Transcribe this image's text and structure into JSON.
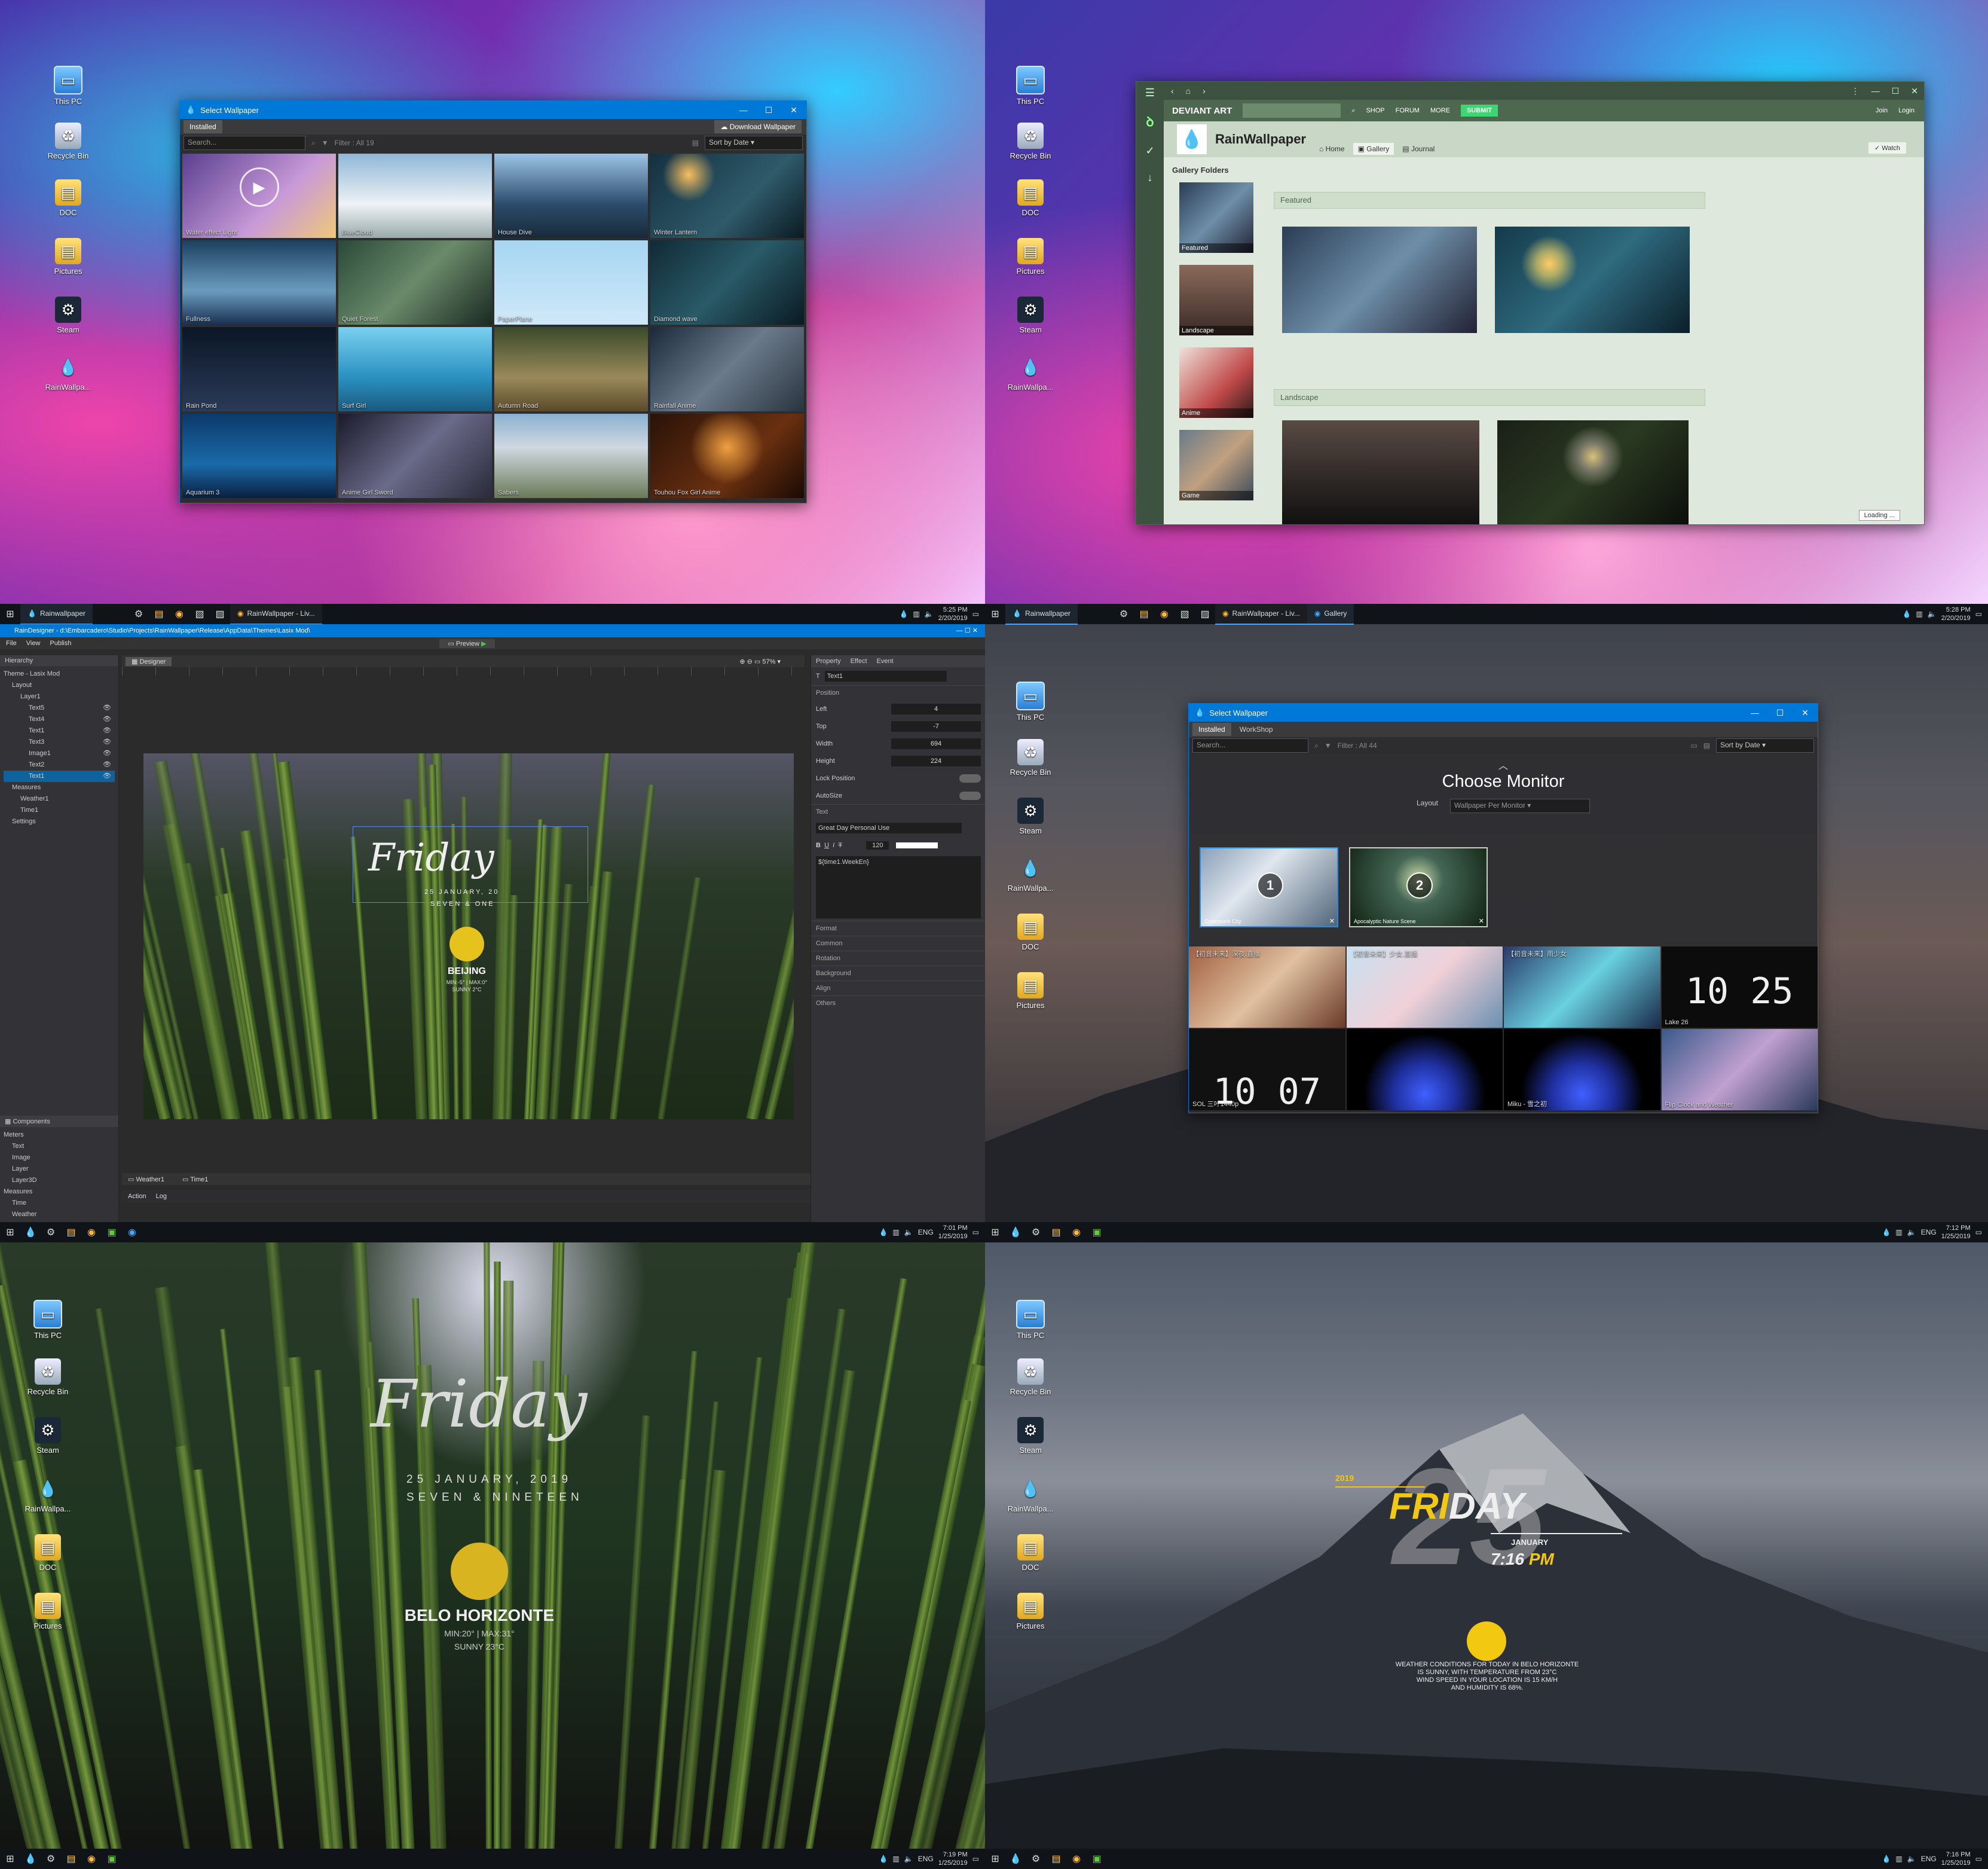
{
  "desktop_icons": {
    "pc": "This PC",
    "bin": "Recycle Bin",
    "doc": "DOC",
    "pics": "Pictures",
    "steam": "Steam",
    "rain": "RainWallpa..."
  },
  "q1": {
    "title": "Select Wallpaper",
    "tab_installed": "Installed",
    "download_btn": "Download Wallpaper",
    "search_placeholder": "Search...",
    "filter": "Filter : All 19",
    "sort": "Sort by Date",
    "tiles": [
      "Water effect Light",
      "BlueCloud",
      "House Dive",
      "Winter Lantern",
      "Fullness",
      "Quiet Forest",
      "PaperPlane",
      "Diamond wave",
      "Rain Pond",
      "Surf Girl",
      "Autumn Road",
      "Rainfall Anime",
      "Aquarium 3",
      "Anime Girl Sword",
      "Sabers",
      "Touhou Fox Girl Anime"
    ]
  },
  "q2": {
    "brand": "DEVIANT ART",
    "nav": [
      "SHOP",
      "FORUM",
      "MORE"
    ],
    "submit": "SUBMIT",
    "join": "Join",
    "login": "Login",
    "profile": "RainWallpaper",
    "tabs": [
      "Home",
      "Gallery",
      "Journal"
    ],
    "watch": "Watch",
    "gallery_folders": "Gallery Folders",
    "folders": [
      "Featured",
      "Landscape",
      "Anime",
      "Game"
    ],
    "featured": "Featured",
    "landscape": "Landscape",
    "loading": "Loading ..."
  },
  "q3": {
    "taskbar_app": "Rainwallpaper",
    "taskbar_chrome": "RainWallpaper - Liv...",
    "time": "5:25 PM",
    "date": "2/20/2019",
    "title": "RainDesigner - d:\\Embarcadero\\Studio\\Projects\\RainWallpaper\\Release\\AppData\\Themes\\Lasix Mod\\",
    "menu": [
      "File",
      "View",
      "Publish"
    ],
    "preview": "Preview",
    "hierarchy": "Hierarchy",
    "designer": "Designer",
    "zoom": "57%",
    "tree": [
      "Theme - Lasix Mod",
      "Layout",
      "Layer1",
      "Text5",
      "Text4",
      "Text1",
      "Text3",
      "Image1",
      "Text2",
      "Text1",
      "Measures",
      "Weather1",
      "Time1",
      "Settings"
    ],
    "components": "Components",
    "comp_tree": [
      "Meters",
      "Text",
      "Image",
      "Layer",
      "Layer3D",
      "Measures",
      "Time",
      "Weather"
    ],
    "prop_tabs": [
      "Property",
      "Effect",
      "Event"
    ],
    "selected": "Text1",
    "position": "Position",
    "props": [
      {
        "k": "Left",
        "v": "4"
      },
      {
        "k": "Top",
        "v": "-7"
      },
      {
        "k": "Width",
        "v": "694"
      },
      {
        "k": "Height",
        "v": "224"
      }
    ],
    "lock": "Lock Position",
    "autosize": "AutoSize",
    "text_sect": "Text",
    "font": "Great Day Personal Use",
    "font_size": "120",
    "text_value": "${time1.WeekEn}",
    "sections": [
      "Format",
      "Common",
      "Rotation",
      "Background",
      "Align",
      "Others"
    ],
    "day": "Friday",
    "date_line": "25 JANUARY, 20",
    "sub_line": "SEVEN & ONE",
    "city": "BEIJING",
    "minmax": "MIN:-5° | MAX:0°",
    "cond": "SUNNY 2°C",
    "bottom_tabs": [
      "Weather1",
      "Time1"
    ],
    "log_tabs": [
      "Action",
      "Log"
    ]
  },
  "q4": {
    "taskbar_app": "Rainwallpaper",
    "taskbar_chrome": "RainWallpaper - Liv...",
    "taskbar_gallery": "Gallery",
    "time": "5:28 PM",
    "date": "2/20/2019",
    "title": "Select Wallpaper",
    "tabs": [
      "Installed",
      "WorkShop"
    ],
    "search_placeholder": "Search...",
    "filter": "Filter : All 44",
    "sort": "Sort by Date",
    "choose": "Choose Monitor",
    "layout_label": "Layout",
    "layout_value": "Wallpaper Per Monitor",
    "mon1": "1",
    "mon2": "2",
    "mon1_name": "Cyberpunk City",
    "mon2_name": "Apocalyptic Nature Scene",
    "tiles": [
      "【初音未来】深夜.直播",
      "【初音未来】少女.直播",
      "【初音未来】雨少女",
      "Lake 26",
      "SOL 三叶1440p",
      "",
      "Miku - 雪之初",
      "Flip Clock and Weather"
    ],
    "clock1": "10 25",
    "clock2": "10 07"
  },
  "q5": {
    "time": "7:01 PM",
    "date": "1/25/2019",
    "time2": "7:19 PM",
    "date2": "1/25/2019",
    "lang": "ENG",
    "day": "Friday",
    "date_line": "25 JANUARY, 2019",
    "sub_line": "SEVEN & NINETEEN",
    "city": "BELO HORIZONTE",
    "minmax": "MIN:20° | MAX:31°",
    "cond": "SUNNY 23°C"
  },
  "q6": {
    "time": "7:12 PM",
    "date": "1/25/2019",
    "time2": "7:16 PM",
    "date2": "1/25/2019",
    "lang": "ENG",
    "year": "2019",
    "big": "25",
    "fri": "FRI",
    "day": "DAY",
    "month": "JANUARY",
    "clock": "7:16",
    "ampm": "PM",
    "weather": [
      "WEATHER CONDITIONS FOR TODAY IN BELO HORIZONTE",
      "IS SUNNY, WITH TEMPERATURE FROM 23°C",
      "WIND SPEED IN YOUR LOCATION IS 15 KM/H",
      "AND HUMIDITY IS 68%."
    ]
  }
}
